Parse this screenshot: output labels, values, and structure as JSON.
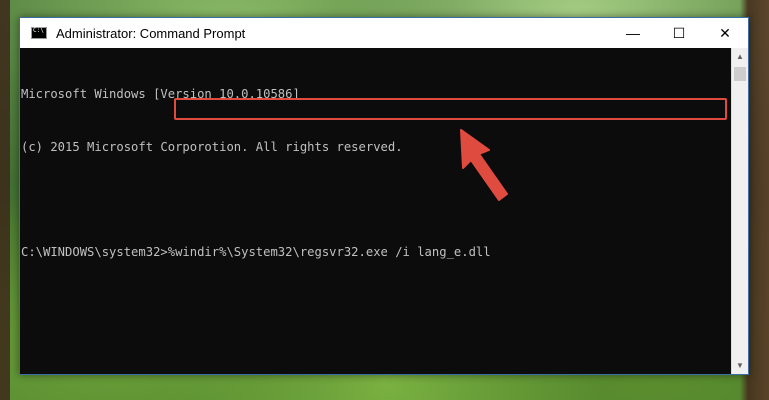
{
  "window": {
    "title": "Administrator: Command Prompt",
    "controls": {
      "minimize": "—",
      "maximize": "☐",
      "close": "✕"
    }
  },
  "console": {
    "lines": [
      "Microsoft Windows [Version 10.0.10586]",
      "(c) 2015 Microsoft Corporotion. All rights reserved.",
      "",
      "C:\\WINDOWS\\system32>%windir%\\System32\\regsvr32.exe /i lang_e.dll"
    ]
  },
  "scrollbar": {
    "up": "▲",
    "down": "▼"
  },
  "colors": {
    "highlight": "#e04b3f",
    "console_bg": "#0c0c0c",
    "console_text": "#c0c0c0"
  },
  "annotations": {
    "arrow_icon": "red-arrow-pointer"
  }
}
